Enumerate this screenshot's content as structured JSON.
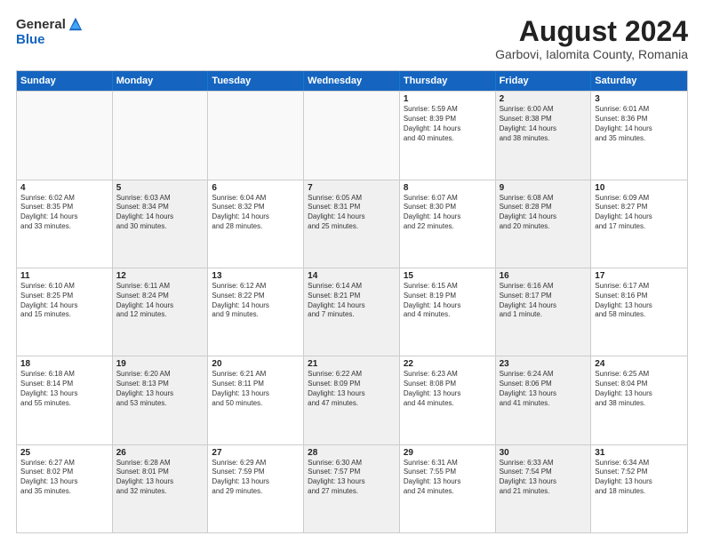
{
  "logo": {
    "general": "General",
    "blue": "Blue"
  },
  "title": "August 2024",
  "location": "Garbovi, Ialomita County, Romania",
  "headers": [
    "Sunday",
    "Monday",
    "Tuesday",
    "Wednesday",
    "Thursday",
    "Friday",
    "Saturday"
  ],
  "rows": [
    [
      {
        "day": "",
        "text": "",
        "empty": true
      },
      {
        "day": "",
        "text": "",
        "empty": true
      },
      {
        "day": "",
        "text": "",
        "empty": true
      },
      {
        "day": "",
        "text": "",
        "empty": true
      },
      {
        "day": "1",
        "text": "Sunrise: 5:59 AM\nSunset: 8:39 PM\nDaylight: 14 hours\nand 40 minutes.",
        "shaded": false
      },
      {
        "day": "2",
        "text": "Sunrise: 6:00 AM\nSunset: 8:38 PM\nDaylight: 14 hours\nand 38 minutes.",
        "shaded": true
      },
      {
        "day": "3",
        "text": "Sunrise: 6:01 AM\nSunset: 8:36 PM\nDaylight: 14 hours\nand 35 minutes.",
        "shaded": false
      }
    ],
    [
      {
        "day": "4",
        "text": "Sunrise: 6:02 AM\nSunset: 8:35 PM\nDaylight: 14 hours\nand 33 minutes.",
        "shaded": false
      },
      {
        "day": "5",
        "text": "Sunrise: 6:03 AM\nSunset: 8:34 PM\nDaylight: 14 hours\nand 30 minutes.",
        "shaded": true
      },
      {
        "day": "6",
        "text": "Sunrise: 6:04 AM\nSunset: 8:32 PM\nDaylight: 14 hours\nand 28 minutes.",
        "shaded": false
      },
      {
        "day": "7",
        "text": "Sunrise: 6:05 AM\nSunset: 8:31 PM\nDaylight: 14 hours\nand 25 minutes.",
        "shaded": true
      },
      {
        "day": "8",
        "text": "Sunrise: 6:07 AM\nSunset: 8:30 PM\nDaylight: 14 hours\nand 22 minutes.",
        "shaded": false
      },
      {
        "day": "9",
        "text": "Sunrise: 6:08 AM\nSunset: 8:28 PM\nDaylight: 14 hours\nand 20 minutes.",
        "shaded": true
      },
      {
        "day": "10",
        "text": "Sunrise: 6:09 AM\nSunset: 8:27 PM\nDaylight: 14 hours\nand 17 minutes.",
        "shaded": false
      }
    ],
    [
      {
        "day": "11",
        "text": "Sunrise: 6:10 AM\nSunset: 8:25 PM\nDaylight: 14 hours\nand 15 minutes.",
        "shaded": false
      },
      {
        "day": "12",
        "text": "Sunrise: 6:11 AM\nSunset: 8:24 PM\nDaylight: 14 hours\nand 12 minutes.",
        "shaded": true
      },
      {
        "day": "13",
        "text": "Sunrise: 6:12 AM\nSunset: 8:22 PM\nDaylight: 14 hours\nand 9 minutes.",
        "shaded": false
      },
      {
        "day": "14",
        "text": "Sunrise: 6:14 AM\nSunset: 8:21 PM\nDaylight: 14 hours\nand 7 minutes.",
        "shaded": true
      },
      {
        "day": "15",
        "text": "Sunrise: 6:15 AM\nSunset: 8:19 PM\nDaylight: 14 hours\nand 4 minutes.",
        "shaded": false
      },
      {
        "day": "16",
        "text": "Sunrise: 6:16 AM\nSunset: 8:17 PM\nDaylight: 14 hours\nand 1 minute.",
        "shaded": true
      },
      {
        "day": "17",
        "text": "Sunrise: 6:17 AM\nSunset: 8:16 PM\nDaylight: 13 hours\nand 58 minutes.",
        "shaded": false
      }
    ],
    [
      {
        "day": "18",
        "text": "Sunrise: 6:18 AM\nSunset: 8:14 PM\nDaylight: 13 hours\nand 55 minutes.",
        "shaded": false
      },
      {
        "day": "19",
        "text": "Sunrise: 6:20 AM\nSunset: 8:13 PM\nDaylight: 13 hours\nand 53 minutes.",
        "shaded": true
      },
      {
        "day": "20",
        "text": "Sunrise: 6:21 AM\nSunset: 8:11 PM\nDaylight: 13 hours\nand 50 minutes.",
        "shaded": false
      },
      {
        "day": "21",
        "text": "Sunrise: 6:22 AM\nSunset: 8:09 PM\nDaylight: 13 hours\nand 47 minutes.",
        "shaded": true
      },
      {
        "day": "22",
        "text": "Sunrise: 6:23 AM\nSunset: 8:08 PM\nDaylight: 13 hours\nand 44 minutes.",
        "shaded": false
      },
      {
        "day": "23",
        "text": "Sunrise: 6:24 AM\nSunset: 8:06 PM\nDaylight: 13 hours\nand 41 minutes.",
        "shaded": true
      },
      {
        "day": "24",
        "text": "Sunrise: 6:25 AM\nSunset: 8:04 PM\nDaylight: 13 hours\nand 38 minutes.",
        "shaded": false
      }
    ],
    [
      {
        "day": "25",
        "text": "Sunrise: 6:27 AM\nSunset: 8:02 PM\nDaylight: 13 hours\nand 35 minutes.",
        "shaded": false
      },
      {
        "day": "26",
        "text": "Sunrise: 6:28 AM\nSunset: 8:01 PM\nDaylight: 13 hours\nand 32 minutes.",
        "shaded": true
      },
      {
        "day": "27",
        "text": "Sunrise: 6:29 AM\nSunset: 7:59 PM\nDaylight: 13 hours\nand 29 minutes.",
        "shaded": false
      },
      {
        "day": "28",
        "text": "Sunrise: 6:30 AM\nSunset: 7:57 PM\nDaylight: 13 hours\nand 27 minutes.",
        "shaded": true
      },
      {
        "day": "29",
        "text": "Sunrise: 6:31 AM\nSunset: 7:55 PM\nDaylight: 13 hours\nand 24 minutes.",
        "shaded": false
      },
      {
        "day": "30",
        "text": "Sunrise: 6:33 AM\nSunset: 7:54 PM\nDaylight: 13 hours\nand 21 minutes.",
        "shaded": true
      },
      {
        "day": "31",
        "text": "Sunrise: 6:34 AM\nSunset: 7:52 PM\nDaylight: 13 hours\nand 18 minutes.",
        "shaded": false
      }
    ]
  ]
}
